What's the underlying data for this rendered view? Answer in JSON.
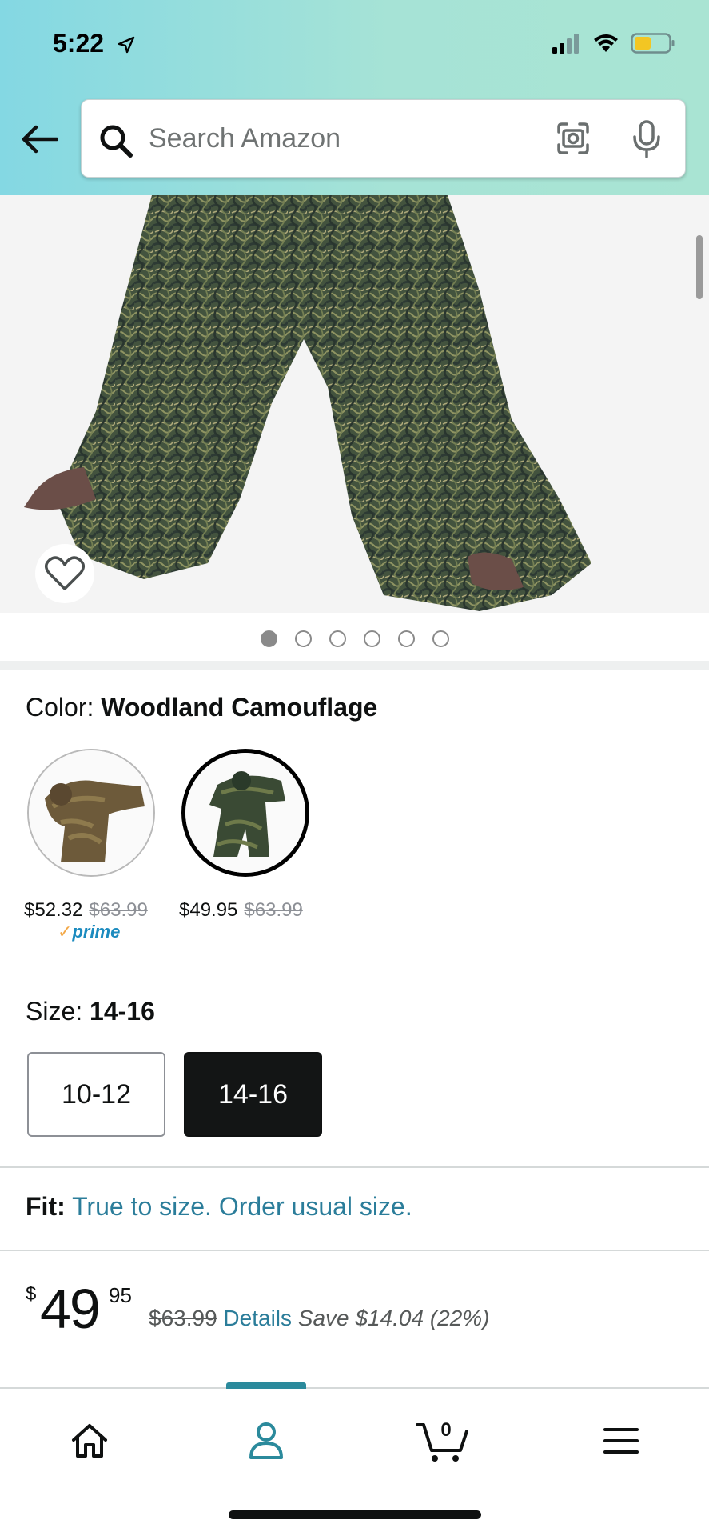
{
  "status_bar": {
    "time": "5:22"
  },
  "search": {
    "placeholder": "Search Amazon"
  },
  "gallery": {
    "dot_count": 6,
    "active_index": 0
  },
  "color": {
    "label": "Color:",
    "selected": "Woodland Camouflage",
    "options": [
      {
        "price": "$52.32",
        "list_price": "$63.99",
        "badge": "prime"
      },
      {
        "price": "$49.95",
        "list_price": "$63.99"
      }
    ]
  },
  "size": {
    "label": "Size:",
    "selected": "14-16",
    "options": [
      "10-12",
      "14-16"
    ]
  },
  "fit": {
    "label": "Fit:",
    "text": "True to size. Order usual size."
  },
  "price": {
    "symbol": "$",
    "whole": "49",
    "fraction": "95",
    "list_price": "$63.99",
    "details_label": "Details",
    "savings": "Save $14.04 (22%)"
  },
  "nav": {
    "cart_count": "0"
  },
  "colors": {
    "link": "#2b7d9a",
    "accent": "#2b8a9c",
    "prime": "#1c8bbf"
  }
}
